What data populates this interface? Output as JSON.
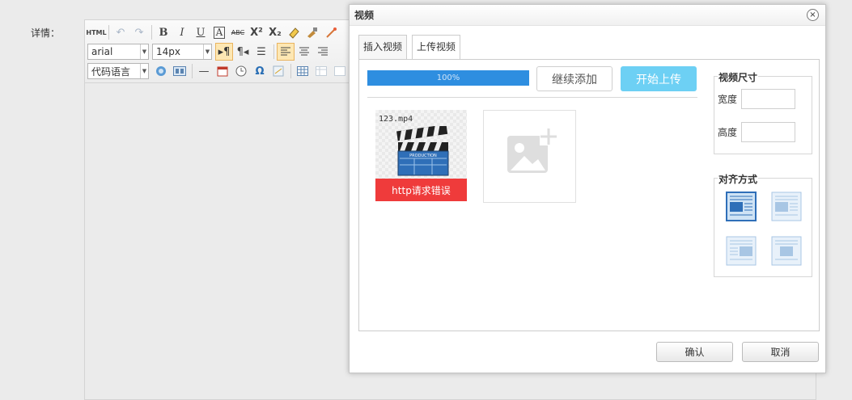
{
  "page": {
    "field_label": "详情："
  },
  "toolbar": {
    "html_label": "HTML",
    "bold": "B",
    "italic": "I",
    "underline": "U",
    "font_border": "A",
    "strike": "ABC",
    "sup": "X²",
    "sub": "X₂",
    "font_family": "arial",
    "font_size": "14px",
    "code_lang": "代码语言",
    "omega": "Ω"
  },
  "dialog": {
    "title": "视频",
    "close_icon": "×",
    "tabs": [
      {
        "label": "插入视频"
      },
      {
        "label": "上传视频"
      }
    ],
    "progress": {
      "text": "100%",
      "value": 100
    },
    "add_button": "继续添加",
    "start_button": "开始上传",
    "file": {
      "name": "123.mp4",
      "status": "http请求错误",
      "clapper_text": "PRODUCTION"
    },
    "size_section": {
      "legend": "视频尺寸",
      "width_label": "宽度",
      "height_label": "高度"
    },
    "align_section": {
      "legend": "对齐方式"
    },
    "ok_button": "确认",
    "cancel_button": "取消"
  },
  "colors": {
    "progress": "#2e8ee0",
    "start_button": "#6dd0f4",
    "error": "#ef3b3b"
  }
}
